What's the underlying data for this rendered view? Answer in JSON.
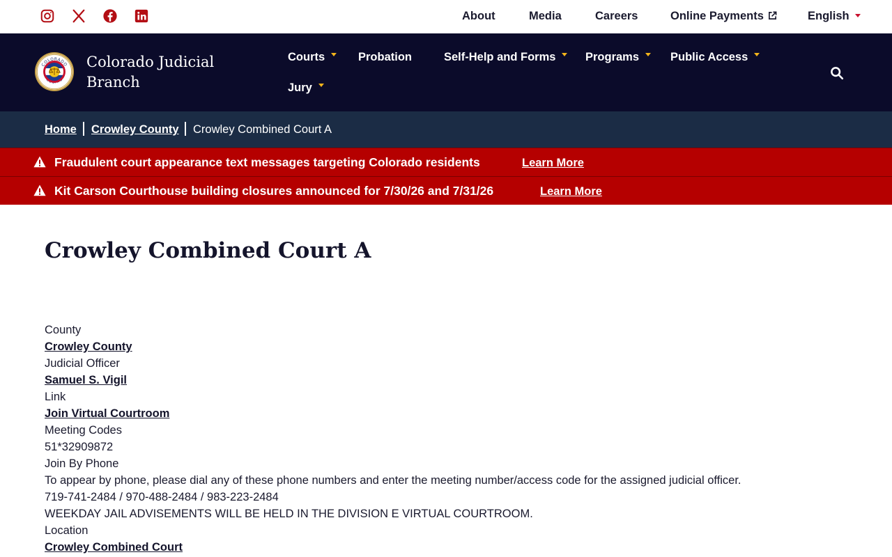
{
  "utility_bar": {
    "links": {
      "about": "About",
      "media": "Media",
      "careers": "Careers",
      "online_payments": "Online Payments",
      "language": "English"
    },
    "social_icons": [
      "instagram-icon",
      "x-icon",
      "facebook-icon",
      "linkedin-icon"
    ]
  },
  "header": {
    "site_title": "Colorado Judicial Branch",
    "seal_text_top": "COLORADO",
    "seal_text_bottom": "COURTS",
    "nav": {
      "courts": "Courts",
      "probation": "Probation",
      "self_help": "Self-Help and Forms",
      "programs": "Programs",
      "public_access": "Public Access",
      "jury": "Jury"
    }
  },
  "breadcrumb": {
    "home": "Home",
    "county": "Crowley County",
    "current": "Crowley Combined Court A"
  },
  "alerts": [
    {
      "text": "Fraudulent court appearance text messages targeting Colorado residents",
      "link": "Learn More"
    },
    {
      "text": "Kit Carson Courthouse building closures announced for 7/30/26 and 7/31/26",
      "link": "Learn More"
    }
  ],
  "main": {
    "title": "Crowley Combined Court A",
    "details": {
      "county_label": "County",
      "county_value": "Crowley County",
      "officer_label": "Judicial Officer",
      "officer_value": "Samuel S. Vigil",
      "link_label": "Link",
      "link_value": "Join Virtual Courtroom",
      "codes_label": "Meeting Codes",
      "codes_value": "51*32909872",
      "phone_label": "Join By Phone",
      "phone_instructions": "To appear by phone, please dial any of these phone numbers and enter the meeting number/access code for the assigned judicial officer.",
      "phone_numbers": "719-741-2484 / 970-488-2484 / 983-223-2484",
      "advisement_note": "WEEKDAY JAIL ADVISEMENTS WILL BE HELD IN THE DIVISION E VIRTUAL COURTROOM.",
      "location_label": "Location",
      "location_value": "Crowley Combined Court"
    }
  },
  "colors": {
    "brand_navy": "#0b0b2a",
    "breadcrumb_bg": "#1b2c45",
    "alert_red": "#b50000",
    "accent_gold": "#f3b41b",
    "social_red": "#b30e14"
  }
}
